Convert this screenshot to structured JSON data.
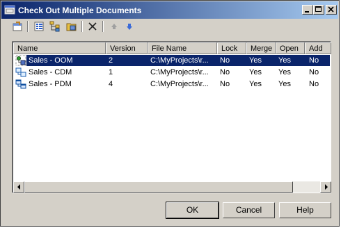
{
  "window": {
    "title": "Check Out Multiple Documents"
  },
  "toolbar": {
    "tools": [
      {
        "name": "properties-tool-icon"
      },
      {
        "name": "select-all-icon"
      },
      {
        "name": "select-tree-icon"
      },
      {
        "name": "select-folder-icon"
      },
      {
        "name": "delete-icon"
      },
      {
        "name": "move-up-icon"
      },
      {
        "name": "move-down-icon"
      }
    ]
  },
  "table": {
    "columns": [
      "Name",
      "Version",
      "File Name",
      "Lock",
      "Merge",
      "Open",
      "Add"
    ],
    "rows": [
      {
        "icon": "oom-model-icon",
        "name": "Sales - OOM",
        "version": "2",
        "file": "C:\\MyProjects\\r...",
        "lock": "No",
        "merge": "Yes",
        "open": "Yes",
        "add": "No",
        "selected": true
      },
      {
        "icon": "cdm-model-icon",
        "name": "Sales - CDM",
        "version": "1",
        "file": "C:\\MyProjects\\r...",
        "lock": "No",
        "merge": "Yes",
        "open": "Yes",
        "add": "No",
        "selected": false
      },
      {
        "icon": "pdm-model-icon",
        "name": "Sales - PDM",
        "version": "4",
        "file": "C:\\MyProjects\\r...",
        "lock": "No",
        "merge": "Yes",
        "open": "Yes",
        "add": "No",
        "selected": false
      }
    ]
  },
  "buttons": {
    "ok": "OK",
    "cancel": "Cancel",
    "help": "Help"
  },
  "colors": {
    "selection": "#0a246a",
    "title_start": "#0a246a",
    "title_end": "#a6caf0",
    "face": "#d4d0c8"
  }
}
